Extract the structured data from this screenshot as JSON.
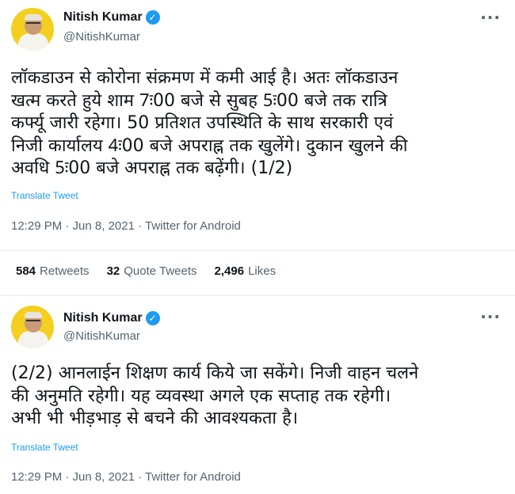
{
  "tweet1": {
    "name": "Nitish Kumar",
    "verified_icon": "verified-badge-icon",
    "handle": "@NitishKumar",
    "more_icon": "more-dots-icon",
    "text": "लॉकडाउन से कोरोना संक्रमण में कमी आई है। अतः लॉकडाउन\nखत्म करते हुये शाम 7ः00 बजे से सुबह 5ः00 बजे तक रात्रि\nकर्फ्यू जारी रहेगा। 50 प्रतिशत उपस्थिति के साथ सरकारी एवं\nनिजी कार्यालय 4ः00 बजे अपराह्न तक खुलेंगे। दुकान खुलने की\nअवधि 5ः00 बजे अपराह्न तक बढ़ेंगी। (1/2)",
    "translate_label": "Translate Tweet",
    "meta": "12:29 PM · Jun 8, 2021 · Twitter for Android",
    "stats": {
      "retweets_count": "584",
      "retweets_label": "Retweets",
      "quotes_count": "32",
      "quotes_label": "Quote Tweets",
      "likes_count": "2,496",
      "likes_label": "Likes"
    }
  },
  "tweet2": {
    "name": "Nitish Kumar",
    "verified_icon": "verified-badge-icon",
    "handle": "@NitishKumar",
    "more_icon": "more-dots-icon",
    "text": "(2/2) आनलाईन शिक्षण कार्य किये जा सकेंगे। निजी वाहन चलने\nकी अनुमति रहेगी। यह व्यवस्था अगले एक सप्ताह तक रहेगी।\nअभी भी भीड़भाड़ से बचने की आवश्यकता है।",
    "translate_label": "Translate Tweet",
    "meta": "12:29 PM · Jun 8, 2021 · Twitter for Android"
  },
  "colors": {
    "accent": "#1d9bf0",
    "secondary_text": "#536471",
    "avatar_bg": "#f4cf1f"
  }
}
